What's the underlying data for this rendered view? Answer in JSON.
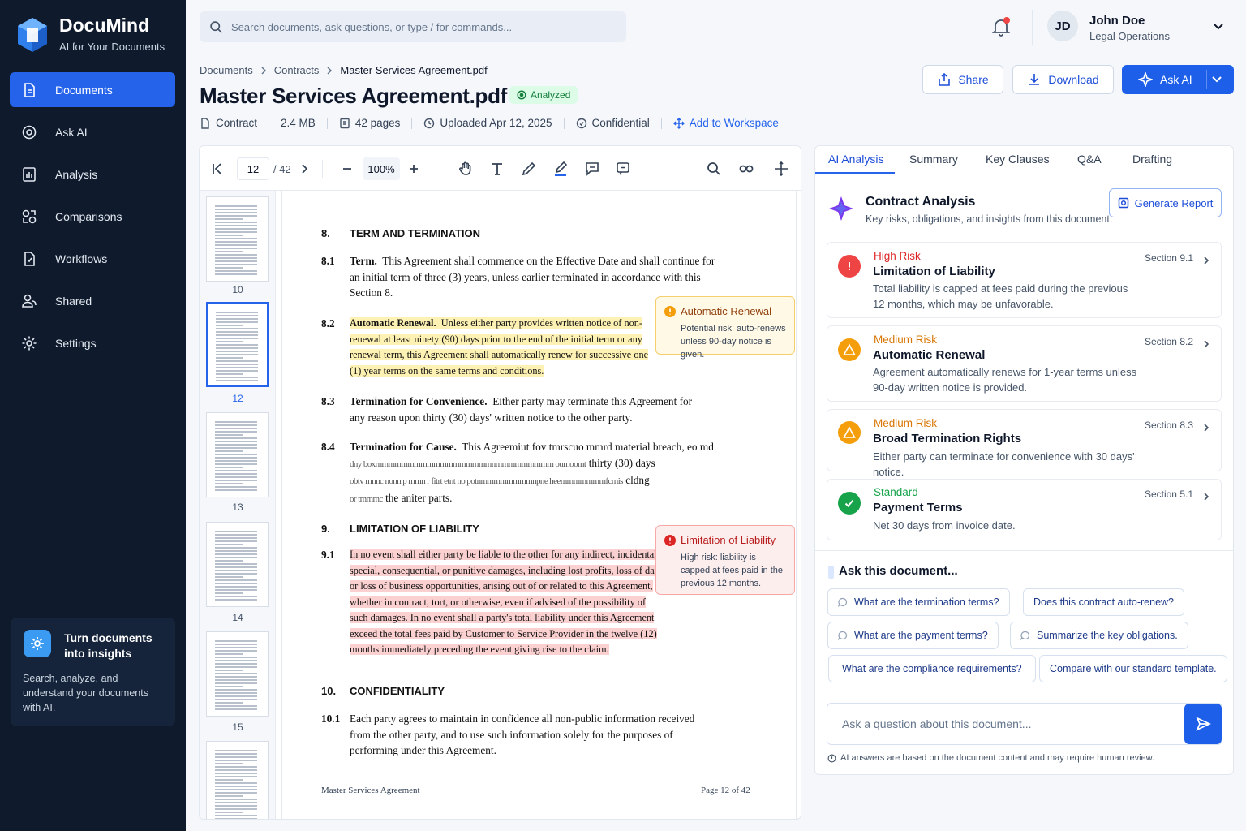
{
  "app": {
    "name": "DocuMind",
    "tagline": "AI for Your Documents"
  },
  "colors": {
    "accent": "#2563eb",
    "sidebar": "#0f1b2d",
    "high_risk": "#dc2626",
    "medium_risk": "#f59e0b",
    "standard": "#16a34a"
  },
  "sidebar": {
    "items": [
      {
        "label": "Documents",
        "icon": "document-icon",
        "active": true
      },
      {
        "label": "Ask AI",
        "icon": "chat-icon"
      },
      {
        "label": "Analysis",
        "icon": "analysis-icon"
      },
      {
        "label": "Comparisons",
        "icon": "compare-icon"
      },
      {
        "label": "Workflows",
        "icon": "workflow-icon"
      },
      {
        "label": "Shared",
        "icon": "users-icon"
      },
      {
        "label": "Settings",
        "icon": "gear-icon"
      }
    ],
    "promo": {
      "title": "Turn documents into insights",
      "text": "Search, analyze, and understand your documents with AI."
    }
  },
  "search": {
    "placeholder": "Search documents, ask questions, or type / for commands..."
  },
  "user": {
    "initials": "JD",
    "name": "John Doe",
    "role": "Legal Operations"
  },
  "breadcrumb": [
    "Documents",
    "Contracts",
    "Master Services Agreement.pdf"
  ],
  "document": {
    "title": "Master Services Agreement.pdf",
    "status": "Analyzed",
    "meta": {
      "type": "Contract",
      "size": "2.4 MB",
      "pages": "42 pages",
      "uploaded": "Uploaded Apr 12, 2025",
      "classification": "Confidential",
      "workspace_link": "Add to Workspace"
    }
  },
  "actions": {
    "share": "Share",
    "download": "Download",
    "ask_ai": "Ask AI"
  },
  "viewer": {
    "current_page": "12",
    "total_pages": "/ 42",
    "zoom": "100%",
    "thumbnails": [
      "10",
      "12",
      "13",
      "14",
      "15"
    ],
    "selected_thumbnail": "12",
    "page": {
      "s8": {
        "num": "8.",
        "title": "TERM AND TERMINATION"
      },
      "p81": {
        "num": "8.1",
        "head": "Term.",
        "text": "This Agreement shall commence on the Effective Date and shall continue for an initial term of three (3) years, unless earlier terminated in accordance with this Section 8."
      },
      "p82": {
        "num": "8.2",
        "head": "Automatic Renewal.",
        "text": "Unless either party provides written notice of non-renewal at least ninety (90) days prior to the end of the initial term or any renewal term, this Agreement shall automatically renew for successive one (1) year terms on the same terms and conditions."
      },
      "p83": {
        "num": "8.3",
        "head": "Termination for Convenience.",
        "text": "Either party may terminate this Agreement for any reason upon thirty (30) days' written notice to the other party."
      },
      "p84": {
        "num": "8.4",
        "head": "Termination for Cause.",
        "l1": "This Agreemiut fov tmrscuo mmrd material breach, eo md",
        "l2": "dny boxrnmmmmmmmmmmmmmmmmmnmmmmmmmmm oumoomt",
        "l2b": "thirty (30) days",
        "l3": "obtv mnnc nonn p mmn r fitrt etnt no potnmmmmmmmmnpne heemmmmmmmfcmis",
        "l3b": "cldng",
        "l4a": "or tmmmc",
        "l4b": "the aniter parts."
      },
      "s9": {
        "num": "9.",
        "title": "LIMITATION OF LIABILITY"
      },
      "p91": {
        "num": "9.1",
        "lines": [
          "In no event shall either party be liable to the other for any indirect, incidental,",
          "special, consequential, or punitive damages, including lost profits, loss of data,",
          "or loss of business opportunities, arising out of or related to this Agreement,",
          "whether in contract, tort, or otherwise, even if advised of the possibility of",
          "such damages. In no event shall a party's total liability under this Agreement",
          "exceed the total fees paid by Customer to Service Provider in the twelve (12)",
          "months immediately preceding the event giving rise to the claim."
        ]
      },
      "s10": {
        "num": "10.",
        "title": "CONFIDENTIALITY"
      },
      "p101": {
        "num": "10.1",
        "text": "Each party agrees to maintain in confidence all non-public information received from the other party, and to use such information solely for the purposes of performing under this Agreement."
      },
      "footer_left": "Master Services Agreement",
      "footer_right": "Page 12 of 42"
    },
    "callouts": [
      {
        "title": "Automatic Renewal",
        "body": "Potential risk: auto-renews unless 90-day notice is given."
      },
      {
        "title": "Limitation of Liability",
        "body": "High risk: liability is capped at fees paid in the previous 12 months."
      }
    ]
  },
  "panel": {
    "tabs": [
      "AI Analysis",
      "Summary",
      "Key Clauses",
      "Q&A",
      "Drafting"
    ],
    "analysis": {
      "title": "Contract Analysis",
      "subtitle": "Key risks, obligations, and insights from this document.",
      "generate": "Generate Report",
      "risks": [
        {
          "level": "High Risk",
          "title": "Limitation of Liability",
          "desc": "Total liability is capped at fees paid during the previous 12 months, which may be unfavorable.",
          "section": "Section 9.1"
        },
        {
          "level": "Medium Risk",
          "title": "Automatic Renewal",
          "desc": "Agreement automatically renews for 1-year terms unless 90-day written notice is provided.",
          "section": "Section 8.2"
        },
        {
          "level": "Medium Risk",
          "title": "Broad Termination Rights",
          "desc": "Either party can terminate for convenience with 30 days' notice.",
          "section": "Section 8.3"
        },
        {
          "level": "Standard",
          "title": "Payment Terms",
          "desc": "Net 30 days from invoice date.",
          "section": "Section 5.1"
        }
      ]
    },
    "ask": {
      "title": "Ask this document...",
      "suggestions": [
        "What are the termination terms?",
        "Does this contract auto-renew?",
        "What are the payment terms?",
        "Summarize the key obligations.",
        "What are the compliance requirements?",
        "Compare with our standard template."
      ],
      "placeholder": "Ask a question about this document...",
      "disclaimer": "AI answers are based on the document content and may require human review."
    }
  }
}
